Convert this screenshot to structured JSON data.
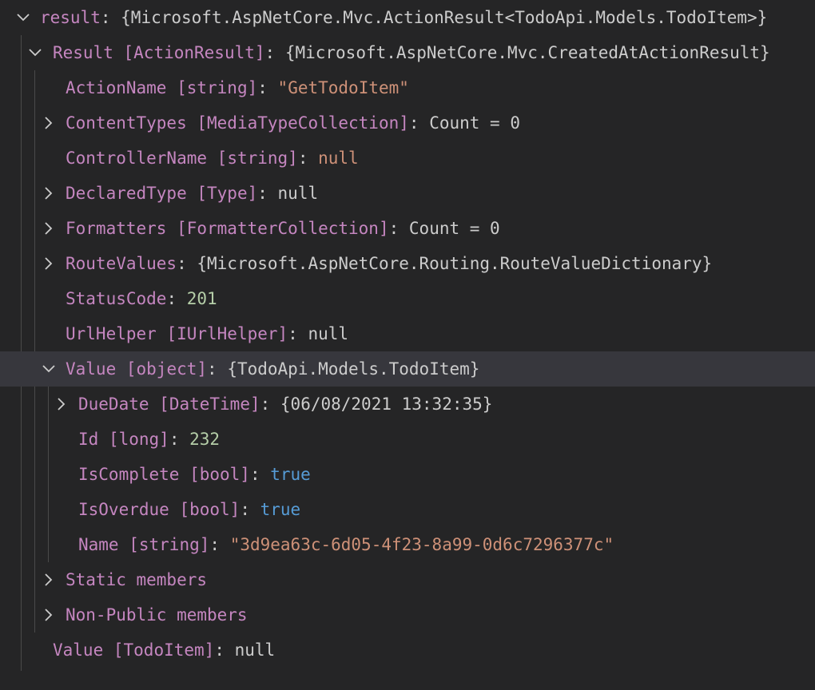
{
  "rows": [
    {
      "name": "result",
      "type": "",
      "value": "{Microsoft.AspNetCore.Mvc.ActionResult<TodoApi.Models.TodoItem>}",
      "value_kind": "default",
      "twisty": "expanded"
    },
    {
      "name": "Result",
      "type": "[ActionResult]",
      "value": "{Microsoft.AspNetCore.Mvc.CreatedAtActionResult}",
      "value_kind": "default",
      "twisty": "expanded"
    },
    {
      "name": "ActionName",
      "type": "[string]",
      "value": "\"GetTodoItem\"",
      "value_kind": "string",
      "twisty": "none"
    },
    {
      "name": "ContentTypes",
      "type": "[MediaTypeCollection]",
      "value": "Count = 0",
      "value_kind": "default",
      "twisty": "collapsed"
    },
    {
      "name": "ControllerName",
      "type": "[string]",
      "value": "null",
      "value_kind": "string",
      "twisty": "none"
    },
    {
      "name": "DeclaredType",
      "type": "[Type]",
      "value": "null",
      "value_kind": "default",
      "twisty": "collapsed"
    },
    {
      "name": "Formatters",
      "type": "[FormatterCollection]",
      "value": "Count = 0",
      "value_kind": "default",
      "twisty": "collapsed"
    },
    {
      "name": "RouteValues",
      "type": "",
      "value": "{Microsoft.AspNetCore.Routing.RouteValueDictionary}",
      "value_kind": "default",
      "twisty": "collapsed"
    },
    {
      "name": "StatusCode",
      "type": "",
      "value": "201",
      "value_kind": "number",
      "twisty": "none"
    },
    {
      "name": "UrlHelper",
      "type": "[IUrlHelper]",
      "value": "null",
      "value_kind": "default",
      "twisty": "none"
    },
    {
      "name": "Value",
      "type": "[object]",
      "value": "{TodoApi.Models.TodoItem}",
      "value_kind": "default",
      "twisty": "expanded",
      "selected": true
    },
    {
      "name": "DueDate",
      "type": "[DateTime]",
      "value": "{06/08/2021 13:32:35}",
      "value_kind": "default",
      "twisty": "collapsed"
    },
    {
      "name": "Id",
      "type": "[long]",
      "value": "232",
      "value_kind": "number",
      "twisty": "none"
    },
    {
      "name": "IsComplete",
      "type": "[bool]",
      "value": "true",
      "value_kind": "bool",
      "twisty": "none"
    },
    {
      "name": "IsOverdue",
      "type": "[bool]",
      "value": "true",
      "value_kind": "bool",
      "twisty": "none"
    },
    {
      "name": "Name",
      "type": "[string]",
      "value": "\"3d9ea63c-6d05-4f23-8a99-0d6c7296377c\"",
      "value_kind": "string",
      "twisty": "none"
    },
    {
      "name": "Static members",
      "type": "",
      "value": "",
      "value_kind": "default",
      "twisty": "collapsed"
    },
    {
      "name": "Non-Public members",
      "type": "",
      "value": "",
      "value_kind": "default",
      "twisty": "collapsed"
    },
    {
      "name": "Value",
      "type": "[TodoItem]",
      "value": "null",
      "value_kind": "default",
      "twisty": "none"
    }
  ],
  "colors": {
    "background": "#252526",
    "selected_row": "#37373d",
    "name": "#c586c0",
    "string": "#ce9178",
    "number": "#b5cea8",
    "bool": "#569cd6",
    "default": "#cccccc"
  },
  "icons": {
    "expanded": "chevron-down-icon",
    "collapsed": "chevron-right-icon"
  }
}
